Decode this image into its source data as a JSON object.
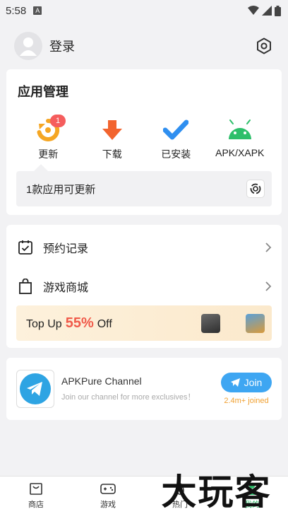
{
  "status": {
    "time": "5:58",
    "notif": "A"
  },
  "header": {
    "login": "登录"
  },
  "app_management": {
    "title": "应用管理",
    "items": [
      {
        "label": "更新",
        "icon": "update-icon",
        "badge": "1"
      },
      {
        "label": "下载",
        "icon": "download-icon"
      },
      {
        "label": "已安装",
        "icon": "installed-icon"
      },
      {
        "label": "APK/XAPK",
        "icon": "android-icon"
      }
    ],
    "update_bar": "1款应用可更新"
  },
  "list": {
    "reservations": "预约记录",
    "store": "游戏商城"
  },
  "promo": {
    "prefix": "Top Up",
    "percent": "55%",
    "suffix": "Off"
  },
  "channel": {
    "title": "APKPure Channel",
    "subtitle": "Join our channel for more exclusives！",
    "join": "Join",
    "joined": "2.4m+ joined"
  },
  "nav": [
    "商店",
    "游戏",
    "热门",
    "我的"
  ],
  "watermark": "大玩客",
  "colors": {
    "accent": "#2dbf6a",
    "orange": "#f5a623",
    "red": "#f55d5d",
    "blue": "#3ea6f2",
    "promo_red": "#f05a4a"
  }
}
